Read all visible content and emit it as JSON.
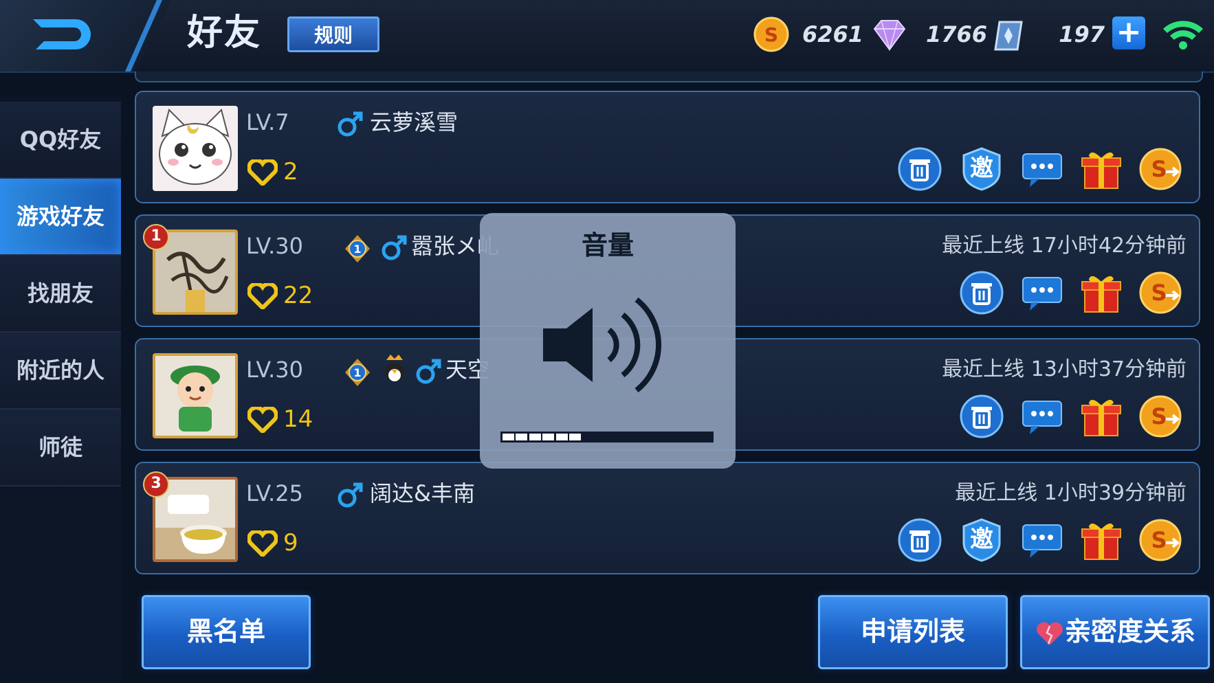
{
  "header": {
    "title": "好友",
    "rules_label": "规则",
    "gold": "6261",
    "diamonds": "1766",
    "vouchers": "197"
  },
  "sidebar": {
    "items": [
      {
        "label": "QQ好友"
      },
      {
        "label": "游戏好友"
      },
      {
        "label": "找朋友"
      },
      {
        "label": "附近的人"
      },
      {
        "label": "师徒"
      }
    ],
    "active_index": 1
  },
  "friends": [
    {
      "level": "LV.7",
      "name": "云萝溪雪",
      "hearts": "2",
      "last_online": ""
    },
    {
      "level": "LV.30",
      "name": "嚣张メ乢",
      "hearts": "22",
      "last_online": "最近上线  17小时42分钟前",
      "rank": "1"
    },
    {
      "level": "LV.30",
      "name": "天空",
      "hearts": "14",
      "last_online": "最近上线  13小时37分钟前"
    },
    {
      "level": "LV.25",
      "name": "阔达&丰南",
      "hearts": "9",
      "last_online": "最近上线  1小时39分钟前",
      "rank": "3"
    }
  ],
  "invite_label": "邀",
  "bottom": {
    "blacklist": "黑名单",
    "requests": "申请列表",
    "intimacy": "亲密度关系"
  },
  "volume": {
    "title": "音量",
    "level": 0.37
  },
  "colors": {
    "accent": "#2d8be0",
    "heart": "#f0c418",
    "gender_male": "#2aa4f0"
  }
}
